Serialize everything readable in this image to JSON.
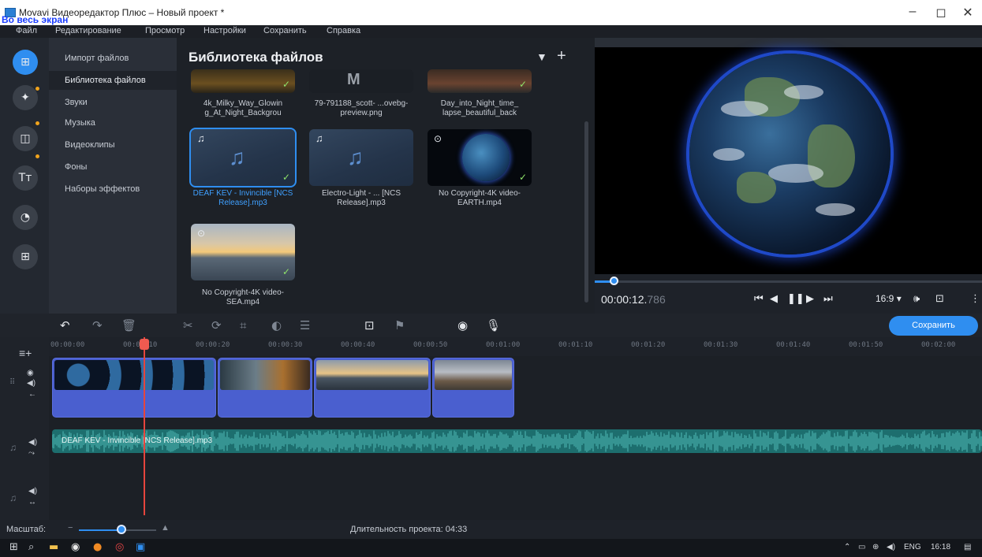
{
  "window": {
    "title": "Movavi Видеоредактор Плюс – Новый проект *",
    "fullscreen_hint": "Во весь экран",
    "minimize": "–",
    "maximize": "◻",
    "close": "✕"
  },
  "menu": [
    "Файл",
    "Редактирование",
    "Просмотр",
    "Настройки",
    "Сохранить",
    "Справка"
  ],
  "left_tools": [
    "import-icon",
    "magic-wand-icon",
    "transition-icon",
    "titles-icon",
    "sticker-icon",
    "more-tools-icon"
  ],
  "categories": [
    {
      "label": "Импорт файлов",
      "active": false
    },
    {
      "label": "Библиотека файлов",
      "active": true
    },
    {
      "label": "Звуки",
      "active": false
    },
    {
      "label": "Музыка",
      "active": false
    },
    {
      "label": "Видеоклипы",
      "active": false
    },
    {
      "label": "Фоны",
      "active": false
    },
    {
      "label": "Наборы эффектов",
      "active": false
    }
  ],
  "library": {
    "title": "Библиотека файлов",
    "filter_icon": "filter-icon",
    "add_icon": "plus-icon",
    "items": [
      {
        "label": "4k_Milky_Way_Glowin g_At_Night_Backgrou",
        "kind": "video"
      },
      {
        "label": "79-791188_scott- ...ovebg-preview.png",
        "kind": "image"
      },
      {
        "label": "Day_into_Night_time_ lapse_beautiful_back",
        "kind": "video"
      },
      {
        "label": "DEAF KEV - Invincible [NCS Release].mp3",
        "kind": "music",
        "selected": true
      },
      {
        "label": "Electro-Light - ... [NCS Release].mp3",
        "kind": "music"
      },
      {
        "label": "No Copyright-4K video-EARTH.mp4",
        "kind": "video"
      },
      {
        "label": "No Copyright-4K video-SEA.mp4",
        "kind": "video"
      }
    ]
  },
  "player": {
    "time_main": "00:00:12.",
    "time_ms": "786",
    "progress": 0.05,
    "aspect": "16:9 ▾",
    "controls": [
      "skip-start-icon",
      "prev-frame-icon",
      "pause-icon",
      "next-frame-icon",
      "skip-end-icon"
    ]
  },
  "toolbar": {
    "save_label": "Сохранить"
  },
  "ruler": [
    "00:00:00",
    "00:00:10",
    "00:00:20",
    "00:00:30",
    "00:00:40",
    "00:00:50",
    "00:01:00",
    "00:01:10",
    "00:01:20",
    "00:01:30",
    "00:01:40",
    "00:01:50",
    "00:02:00"
  ],
  "audio_track": {
    "label": "DEAF KEV - Invincible [NCS Release].mp3"
  },
  "footer": {
    "scale_label": "Масштаб:",
    "scale_value": 0.55,
    "duration": "Длительность проекта: 04:33"
  },
  "taskbar": {
    "lang": "ENG",
    "time": "16:18"
  },
  "colors": {
    "accent": "#2f8ef0",
    "playhead": "#e6453d",
    "audio": "#1d6e6e",
    "clip": "#4a5fcf"
  }
}
